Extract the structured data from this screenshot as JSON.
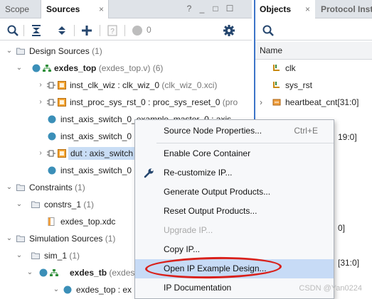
{
  "left_panel": {
    "tabs": [
      {
        "label": "Scope"
      },
      {
        "label": "Sources",
        "close": "×"
      }
    ],
    "window_controls": [
      "?",
      "_",
      "□",
      "☐"
    ],
    "toolbar": {
      "count": "0"
    },
    "tree": [
      {
        "arrow": "⌄",
        "label": "Design Sources",
        "count": "(1)"
      },
      {
        "arrow": "⌄",
        "label": "exdes_top",
        "extra": "(exdes_top.v) (6)"
      },
      {
        "arrow": "›",
        "label": "inst_clk_wiz : clk_wiz_0",
        "extra": "(clk_wiz_0.xci)"
      },
      {
        "arrow": "›",
        "label": "inst_proc_sys_rst_0 : proc_sys_reset_0",
        "extra": "(pro"
      },
      {
        "arrow": "",
        "label": "inst_axis_switch_0_example_master_0 : axis"
      },
      {
        "arrow": "",
        "label": "inst_axis_switch_0"
      },
      {
        "arrow": "›",
        "label": "dut : axis_switch"
      },
      {
        "arrow": "",
        "label": "inst_axis_switch_0"
      },
      {
        "arrow": "⌄",
        "label": "Constraints",
        "count": "(1)"
      },
      {
        "arrow": "⌄",
        "label": "constrs_1",
        "count": "(1)"
      },
      {
        "arrow": "",
        "label": "exdes_top.xdc"
      },
      {
        "arrow": "⌄",
        "label": "Simulation Sources",
        "count": "(1)"
      },
      {
        "arrow": "⌄",
        "label": "sim_1",
        "count": "(1)"
      },
      {
        "arrow": "⌄",
        "label": "exdes_tb",
        "extra": "(exdes"
      },
      {
        "arrow": "⌄",
        "label": "exdes_top : ex"
      }
    ]
  },
  "right_panel": {
    "tabs": [
      {
        "label": "Objects",
        "close": "×"
      },
      {
        "label": "Protocol Inst"
      }
    ],
    "column_header": "Name",
    "rows": [
      {
        "arrow": "",
        "label": "clk"
      },
      {
        "arrow": "",
        "label": "sys_rst"
      },
      {
        "arrow": "›",
        "label": "heartbeat_cnt[31:0]"
      },
      {
        "arrow": "",
        "label": "19:0]"
      },
      {
        "arrow": "",
        "label": "0]"
      },
      {
        "arrow": "",
        "label": "[31:0]"
      }
    ]
  },
  "context_menu": {
    "items": [
      {
        "label": "Source Node Properties...",
        "shortcut": "Ctrl+E"
      },
      {
        "label": "Enable Core Container"
      },
      {
        "label": "Re-customize IP..."
      },
      {
        "label": "Generate Output Products..."
      },
      {
        "label": "Reset Output Products..."
      },
      {
        "label": "Upgrade IP...",
        "disabled": true
      },
      {
        "label": "Copy IP..."
      },
      {
        "label": "Open IP Example Design...",
        "selected": true
      },
      {
        "label": "IP Documentation"
      }
    ]
  },
  "watermark": "CSDN @Yan0224",
  "colors": {
    "accent_blue": "#3c74c8",
    "highlight_oval": "#d9201a",
    "selection": "#c7dbf6",
    "tree_highlight": "#c9ddf5",
    "tab_bar": "#dfe3e8"
  }
}
